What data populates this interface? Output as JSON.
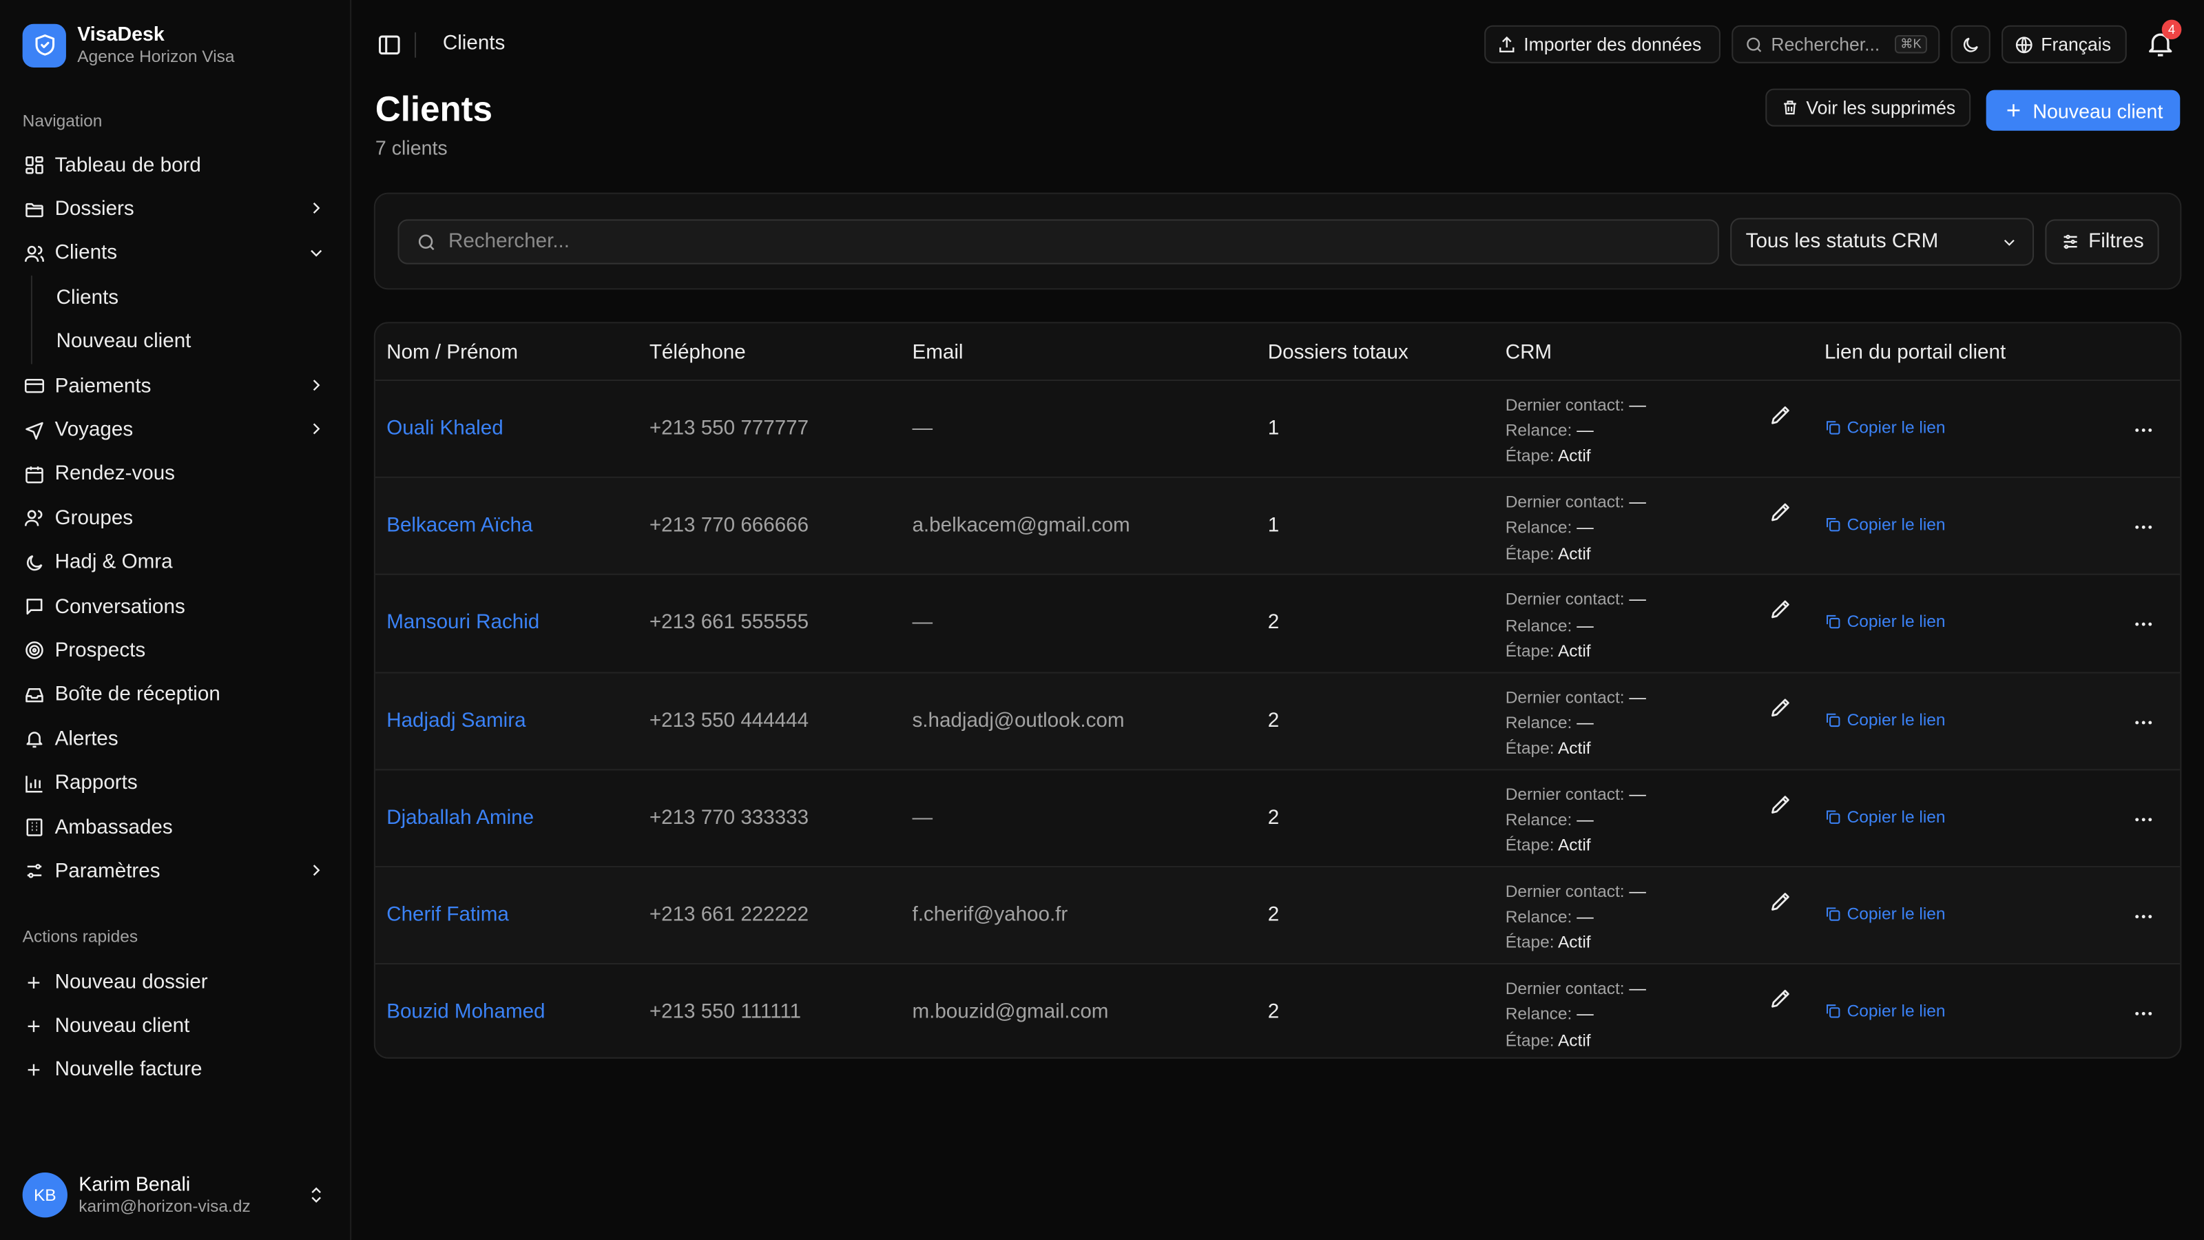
{
  "brand": {
    "name": "VisaDesk",
    "subtitle": "Agence Horizon Visa"
  },
  "sidebar": {
    "nav_label": "Navigation",
    "items": [
      {
        "label": "Tableau de bord",
        "icon": "dashboard-icon"
      },
      {
        "label": "Dossiers",
        "icon": "folder-icon",
        "chevron": "right"
      },
      {
        "label": "Clients",
        "icon": "users-icon",
        "chevron": "down",
        "expanded": true
      },
      {
        "label": "Paiements",
        "icon": "credit-card-icon",
        "chevron": "right"
      },
      {
        "label": "Voyages",
        "icon": "plane-icon",
        "chevron": "right"
      },
      {
        "label": "Rendez-vous",
        "icon": "calendar-icon"
      },
      {
        "label": "Groupes",
        "icon": "group-icon"
      },
      {
        "label": "Hadj & Omra",
        "icon": "moon-icon"
      },
      {
        "label": "Conversations",
        "icon": "message-icon"
      },
      {
        "label": "Prospects",
        "icon": "target-icon"
      },
      {
        "label": "Boîte de réception",
        "icon": "inbox-icon"
      },
      {
        "label": "Alertes",
        "icon": "bell-icon"
      },
      {
        "label": "Rapports",
        "icon": "chart-icon"
      },
      {
        "label": "Ambassades",
        "icon": "building-icon"
      },
      {
        "label": "Paramètres",
        "icon": "settings-icon",
        "chevron": "right"
      }
    ],
    "clients_sub": [
      "Clients",
      "Nouveau client"
    ],
    "quick_label": "Actions rapides",
    "quick_actions": [
      "Nouveau dossier",
      "Nouveau client",
      "Nouvelle facture"
    ]
  },
  "user": {
    "initials": "KB",
    "name": "Karim Benali",
    "email": "karim@horizon-visa.dz"
  },
  "topbar": {
    "breadcrumb": "Clients",
    "import_label": "Importer des données",
    "search_placeholder": "Rechercher...",
    "search_shortcut": "⌘K",
    "language": "Français",
    "notifications": "4"
  },
  "page": {
    "title": "Clients",
    "count": "7 clients",
    "deleted_label": "Voir les supprimés",
    "new_label": "Nouveau client"
  },
  "filters": {
    "search_placeholder": "Rechercher...",
    "status_value": "Tous les statuts CRM",
    "filters_label": "Filtres"
  },
  "table": {
    "columns": [
      "Nom / Prénom",
      "Téléphone",
      "Email",
      "Dossiers totaux",
      "CRM",
      "Lien du portail client"
    ],
    "crm_labels": {
      "last": "Dernier contact:",
      "relance": "Relance:",
      "etape": "Étape:"
    },
    "copy_label": "Copier le lien",
    "rows": [
      {
        "name": "Ouali Khaled",
        "phone": "+213 550 777777",
        "email": "—",
        "dossiers": "1",
        "last": "—",
        "relance": "—",
        "etape": "Actif"
      },
      {
        "name": "Belkacem Aïcha",
        "phone": "+213 770 666666",
        "email": "a.belkacem@gmail.com",
        "dossiers": "1",
        "last": "—",
        "relance": "—",
        "etape": "Actif"
      },
      {
        "name": "Mansouri Rachid",
        "phone": "+213 661 555555",
        "email": "—",
        "dossiers": "2",
        "last": "—",
        "relance": "—",
        "etape": "Actif"
      },
      {
        "name": "Hadjadj Samira",
        "phone": "+213 550 444444",
        "email": "s.hadjadj@outlook.com",
        "dossiers": "2",
        "last": "—",
        "relance": "—",
        "etape": "Actif"
      },
      {
        "name": "Djaballah Amine",
        "phone": "+213 770 333333",
        "email": "—",
        "dossiers": "2",
        "last": "—",
        "relance": "—",
        "etape": "Actif"
      },
      {
        "name": "Cherif Fatima",
        "phone": "+213 661 222222",
        "email": "f.cherif@yahoo.fr",
        "dossiers": "2",
        "last": "—",
        "relance": "—",
        "etape": "Actif"
      },
      {
        "name": "Bouzid Mohamed",
        "phone": "+213 550 111111",
        "email": "m.bouzid@gmail.com",
        "dossiers": "2",
        "last": "—",
        "relance": "—",
        "etape": "Actif"
      }
    ]
  },
  "colors": {
    "accent": "#3b82f6",
    "background": "#0a0a0a",
    "card": "#121212",
    "danger": "#ef4444"
  }
}
